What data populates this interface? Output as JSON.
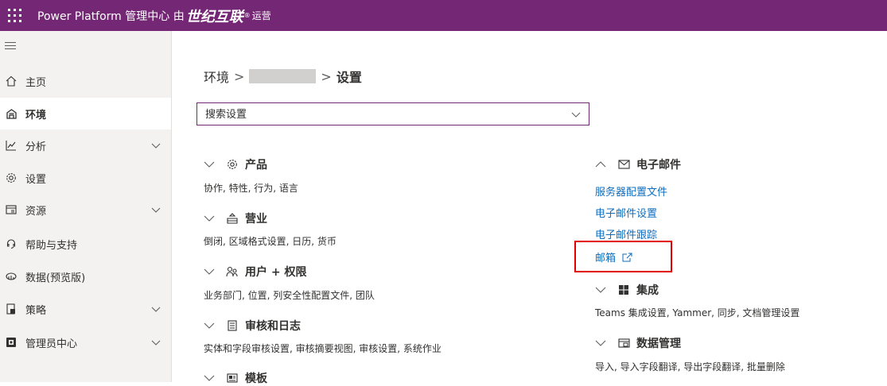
{
  "header": {
    "title": "Power Platform 管理中心 由",
    "brand": "世纪互联",
    "brand_sup": "®",
    "brand_suffix": "运营"
  },
  "sidebar": {
    "items": [
      {
        "label": "主页",
        "icon": "home-icon",
        "active": false,
        "expandable": false
      },
      {
        "label": "环境",
        "icon": "environment-icon",
        "active": true,
        "expandable": false
      },
      {
        "label": "分析",
        "icon": "analytics-icon",
        "active": false,
        "expandable": true
      },
      {
        "label": "设置",
        "icon": "gear-icon",
        "active": false,
        "expandable": false
      },
      {
        "label": "资源",
        "icon": "resources-icon",
        "active": false,
        "expandable": true
      },
      {
        "label": "帮助与支持",
        "icon": "headset-icon",
        "active": false,
        "expandable": false
      },
      {
        "label": "数据(预览版)",
        "icon": "data-icon",
        "active": false,
        "expandable": false
      },
      {
        "label": "策略",
        "icon": "policy-icon",
        "active": false,
        "expandable": true
      },
      {
        "label": "管理员中心",
        "icon": "admin-center-icon",
        "active": false,
        "expandable": true
      }
    ]
  },
  "breadcrumb": {
    "root": "环境",
    "sep": ">",
    "current": "设置"
  },
  "search": {
    "placeholder": "搜索设置"
  },
  "sections_left": [
    {
      "title": "产品",
      "icon": "gear-icon",
      "sub": "协作, 特性, 行为, 语言"
    },
    {
      "title": "营业",
      "icon": "business-icon",
      "sub": "倒闭, 区域格式设置, 日历, 货币"
    },
    {
      "title": "用户 + 权限",
      "icon": "users-icon",
      "sub": "业务部门, 位置, 列安全性配置文件, 团队"
    },
    {
      "title": "审核和日志",
      "icon": "audit-icon",
      "sub": "实体和字段审核设置, 审核摘要视图, 审核设置, 系统作业"
    },
    {
      "title": "模板",
      "icon": "template-icon",
      "sub": ""
    }
  ],
  "sections_right": [
    {
      "title": "电子邮件",
      "icon": "mail-icon",
      "expanded": true,
      "links": [
        "服务器配置文件",
        "电子邮件设置",
        "电子邮件跟踪",
        "邮箱"
      ]
    },
    {
      "title": "集成",
      "icon": "windows-icon",
      "sub": "Teams 集成设置, Yammer, 同步, 文档管理设置"
    },
    {
      "title": "数据管理",
      "icon": "data-management-icon",
      "sub": "导入, 导入字段翻译, 导出字段翻译, 批量删除"
    }
  ],
  "colors": {
    "header": "#742774",
    "link": "#0f6cbd",
    "highlight": "#e00000"
  }
}
